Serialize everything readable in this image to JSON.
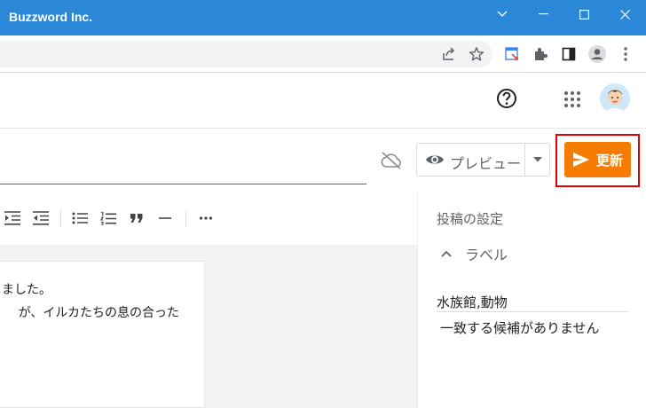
{
  "window": {
    "title": "Buzzword Inc.",
    "title_color": "#2b88d8"
  },
  "browser": {
    "toolbar_icons": [
      "share-icon",
      "star-icon",
      "extension-page-icon",
      "puzzle-icon",
      "side-panel-icon",
      "profile-icon",
      "more-vert-icon"
    ]
  },
  "header": {
    "icons": [
      "help-icon",
      "apps-grid-icon",
      "avatar"
    ]
  },
  "post_editor": {
    "title_value": "",
    "preview_label": "プレビュー",
    "update_label": "更新",
    "accent_color": "#f57c00",
    "highlight_color": "#e00000"
  },
  "editor_toolbar": {
    "icons": [
      "indent-more-icon",
      "indent-less-icon",
      "bulleted-list-icon",
      "numbered-list-icon",
      "quote-icon",
      "horizontal-rule-icon",
      "more-horiz-icon"
    ]
  },
  "document": {
    "lines": [
      "ました。",
      "が、イルカたちの息の合った"
    ]
  },
  "sidebar": {
    "heading": "投稿の設定",
    "section_label": "ラベル",
    "labels_value": "水族館,動物",
    "suggestion": "一致する候補がありません"
  }
}
